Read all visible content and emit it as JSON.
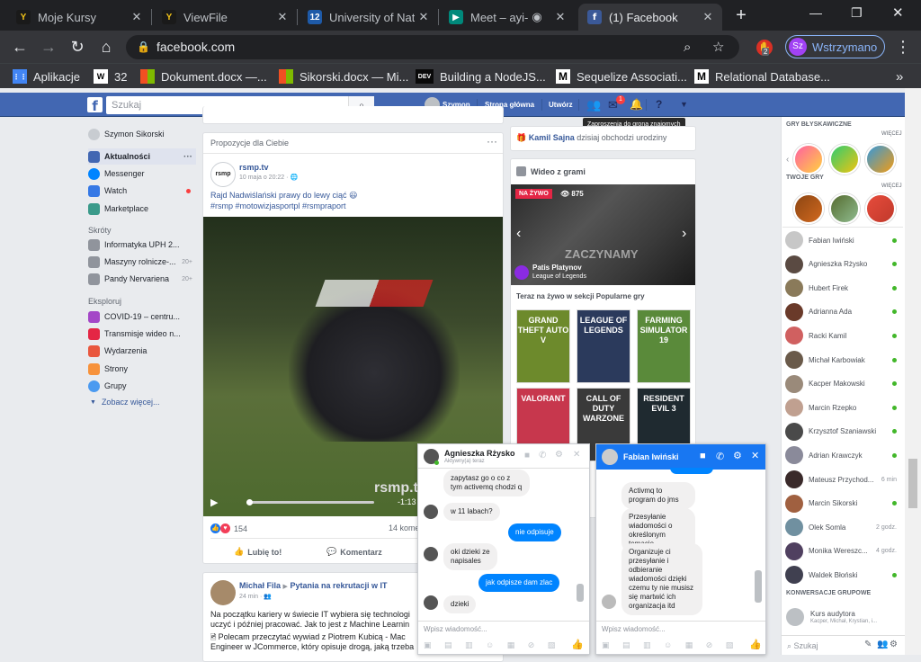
{
  "browser": {
    "tabs": [
      {
        "title": "Moje Kursy",
        "fav_color": "#1a1a1a",
        "fav_glyph": "Y"
      },
      {
        "title": "ViewFile",
        "fav_color": "#1a1a1a",
        "fav_glyph": "Y"
      },
      {
        "title": "University of Natu",
        "fav_color": "#1e5aa8",
        "fav_glyph": "12"
      },
      {
        "title": "Meet – ayi-tv",
        "fav_color": "#00897b",
        "fav_glyph": "▶"
      },
      {
        "title": "(1) Facebook",
        "fav_color": "#3b5998",
        "fav_glyph": "f"
      }
    ],
    "new_tab": "+",
    "url": "facebook.com",
    "profile_initials": "Sz",
    "profile_status": "Wstrzymano",
    "extension_badge": "2",
    "bookmarks": [
      {
        "label": "Aplikacje",
        "fav_color": "#4285f4",
        "fav_glyph": "⋮⋮"
      },
      {
        "label": "32",
        "fav_color": "#ffffff",
        "fav_glyph": "W"
      },
      {
        "label": "Dokument.docx —...",
        "fav_color": "#f25022",
        "fav_glyph": ""
      },
      {
        "label": "Sikorski.docx — Mi...",
        "fav_color": "#f25022",
        "fav_glyph": ""
      },
      {
        "label": "Building a NodeJS...",
        "fav_color": "#0a0a0a",
        "fav_glyph": "DEV"
      },
      {
        "label": "Sequelize Associati...",
        "fav_color": "#ffffff",
        "fav_glyph": "M"
      },
      {
        "label": "Relational Database...",
        "fav_color": "#ffffff",
        "fav_glyph": "M"
      }
    ],
    "more_bookmarks": "»"
  },
  "fb": {
    "search_placeholder": "Szukaj",
    "user": "Szymon",
    "home": "Strona główna",
    "create": "Utwórz",
    "messenger_badge": "1",
    "tooltip": "Zaproszenia do grona znajomych"
  },
  "left_nav": {
    "profile": "Szymon Sikorski",
    "items": [
      {
        "label": "Aktualności",
        "color": "#4267b2"
      },
      {
        "label": "Messenger",
        "color": "#0084ff"
      },
      {
        "label": "Watch",
        "color": "#3578e5"
      },
      {
        "label": "Marketplace",
        "color": "#3a9a8a"
      }
    ],
    "shortcuts_header": "Skróty",
    "shortcuts": [
      {
        "label": "Informatyka UPH 2...",
        "count": ""
      },
      {
        "label": "Maszyny rolnicze-...",
        "count": "20+"
      },
      {
        "label": "Pandy Nervariena",
        "count": "20+"
      }
    ],
    "explore_header": "Eksploruj",
    "explore": [
      {
        "label": "COVID-19 – centru...",
        "color": "#a447c7"
      },
      {
        "label": "Transmisje wideo n...",
        "color": "#e42645"
      },
      {
        "label": "Wydarzenia",
        "color": "#e9573e"
      },
      {
        "label": "Strony",
        "color": "#f7923b"
      },
      {
        "label": "Grupy",
        "color": "#4b9af0"
      }
    ],
    "see_more": "Zobacz więcej..."
  },
  "feed": {
    "suggested_header": "Propozycje dla Ciebie",
    "post1": {
      "author": "rsmp.tv",
      "avatar_text": "rsmp",
      "time": "10 maja o 20:22 · ",
      "text": "Rajd Nadwiślański prawy do lewy ciąć 😃",
      "hashtags": "#rsmp #motowizjasportpl #rsmpraport",
      "video_time": "-1:13",
      "watermark": "rsmp.tv",
      "reactions_count": "154",
      "comments_count": "14 komen",
      "like": "Lubię to!",
      "comment": "Komentarz"
    },
    "post2": {
      "author": "Michał Fila",
      "arrow": "▶",
      "group": "Pytania na rekrutacji w IT",
      "time": "24 min · ",
      "text1": "Na początku kariery w świecie IT wybiera się technologi",
      "text2": "uczyć i później pracować. Jak to jest z Machine Learnin",
      "text3": "Polecam przeczytać wywiad z Piotrem Kubicą - Mac",
      "text4": "Engineer w JCommerce, który opisuje drogą, jaką trzeba"
    }
  },
  "right_col": {
    "birthday_name": "Kamil Sajna",
    "birthday_text": " dzisiaj obchodzi urodziny",
    "games_header": "Wideo z grami",
    "live_label": "NA ŻYWO",
    "viewers": "875",
    "streamer": "Patis Platynov",
    "game": "League of Legends",
    "banner_text": "ZACZYNAMY",
    "popular": "Teraz na żywo w sekcji Popularne gry",
    "tiles": [
      {
        "label": "GRAND THEFT AUTO V",
        "bg": "#6d8a2c"
      },
      {
        "label": "LEAGUE OF LEGENDS",
        "bg": "#2b3a5c"
      },
      {
        "label": "FARMING SIMULATOR 19",
        "bg": "#5a8a3a"
      },
      {
        "label": "VALORANT",
        "bg": "#c7374d"
      },
      {
        "label": "CALL OF DUTY WARZONE",
        "bg": "#3a3a3a"
      },
      {
        "label": "RESIDENT EVIL 3",
        "bg": "#1f2a30"
      }
    ]
  },
  "sidebar": {
    "instant_games": "GRY BŁYSKAWICZNE",
    "more": "WIĘCEJ",
    "your_games": "TWOJE GRY",
    "more2": "WIĘCEJ",
    "contacts": [
      {
        "name": "Fabian Iwiński",
        "online": true,
        "time": ""
      },
      {
        "name": "Agnieszka Rżysko",
        "online": true,
        "time": ""
      },
      {
        "name": "Hubert Firek",
        "online": true,
        "time": ""
      },
      {
        "name": "Adrianna Ada",
        "online": true,
        "time": ""
      },
      {
        "name": "Racki Kamil",
        "online": true,
        "time": ""
      },
      {
        "name": "Michał Karbowiak",
        "online": true,
        "time": ""
      },
      {
        "name": "Kacper Makowski",
        "online": true,
        "time": ""
      },
      {
        "name": "Marcin Rzepko",
        "online": true,
        "time": ""
      },
      {
        "name": "Krzysztof Szaniawski",
        "online": true,
        "time": ""
      },
      {
        "name": "Adrian Krawczyk",
        "online": true,
        "time": ""
      },
      {
        "name": "Mateusz Przychod...",
        "online": false,
        "time": "6 min"
      },
      {
        "name": "Marcin Sikorski",
        "online": true,
        "time": ""
      },
      {
        "name": "Olek Somla",
        "online": false,
        "time": "2 godz."
      },
      {
        "name": "Monika Wereszc...",
        "online": false,
        "time": "4 godz."
      },
      {
        "name": "Waldek Błoński",
        "online": true,
        "time": ""
      }
    ],
    "groups_header": "KONWERSACJE GRUPOWE",
    "group_name": "Kurs audytora",
    "group_members": "Kacper, Michał, Krystian, i...",
    "search_placeholder": "Szukaj"
  },
  "chat1": {
    "name": "Agnieszka Rżysko",
    "status": "Aktywny(a) teraz",
    "msgs": [
      "zapytasz go o co z tym activemq chodzi q",
      "w 11 labach?",
      "nie odpisuje",
      "oki dzieki ze napisales",
      "jak odpisze dam zlac",
      "dzieki"
    ],
    "placeholder": "Wpisz wiadomość..."
  },
  "chat2": {
    "name": "Fabian Iwiński",
    "msgs": [
      "Activmq to program do jms",
      "Przesyłanie wiadomości o określonym temacie",
      "Organizuje ci przesyłanie i odbieranie wiadomości dzięki czemu ty nie musisz się martwić ich organizacja itd"
    ],
    "placeholder": "Wpisz wiadomość..."
  }
}
